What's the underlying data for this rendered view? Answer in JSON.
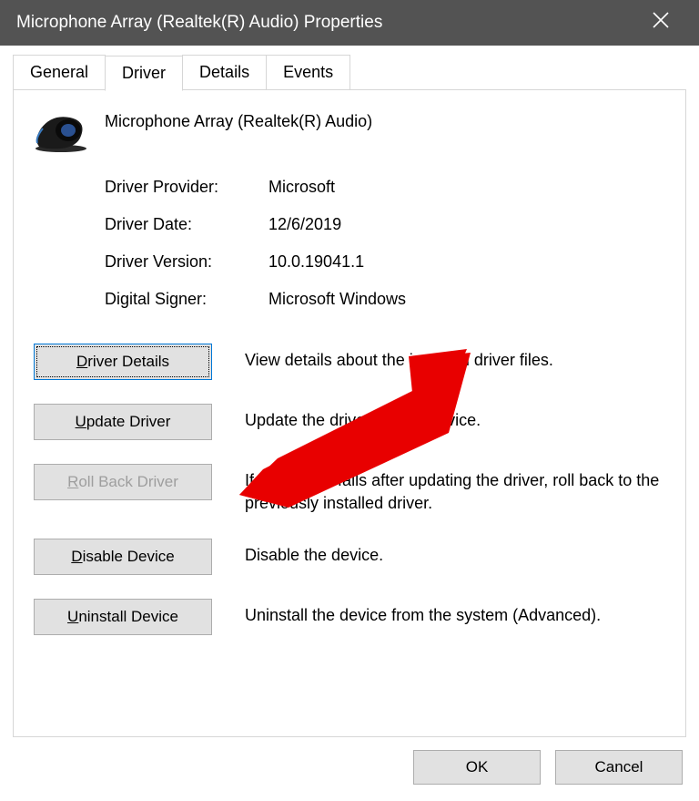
{
  "window": {
    "title": "Microphone Array (Realtek(R) Audio) Properties"
  },
  "tabs": {
    "general": "General",
    "driver": "Driver",
    "details": "Details",
    "events": "Events",
    "active": "driver"
  },
  "device": {
    "name": "Microphone Array (Realtek(R) Audio)"
  },
  "info": {
    "provider_label": "Driver Provider:",
    "provider_value": "Microsoft",
    "date_label": "Driver Date:",
    "date_value": "12/6/2019",
    "version_label": "Driver Version:",
    "version_value": "10.0.19041.1",
    "signer_label": "Digital Signer:",
    "signer_value": "Microsoft Windows"
  },
  "actions": {
    "details_label_pre": "D",
    "details_label_post": "river Details",
    "details_desc": "View details about the installed driver files.",
    "update_label_pre": "U",
    "update_label_post": "pdate Driver",
    "update_desc": "Update the driver for this device.",
    "rollback_label_pre": "R",
    "rollback_label_post": "oll Back Driver",
    "rollback_desc": "If the device fails after updating the driver, roll back to the previously installed driver.",
    "disable_label_pre": "D",
    "disable_label_post": "isable Device",
    "disable_desc": "Disable the device.",
    "uninstall_label_pre": "U",
    "uninstall_label_post": "ninstall Device",
    "uninstall_desc": "Uninstall the device from the system (Advanced)."
  },
  "footer": {
    "ok": "OK",
    "cancel": "Cancel"
  },
  "annotation": {
    "color": "#e80000"
  }
}
